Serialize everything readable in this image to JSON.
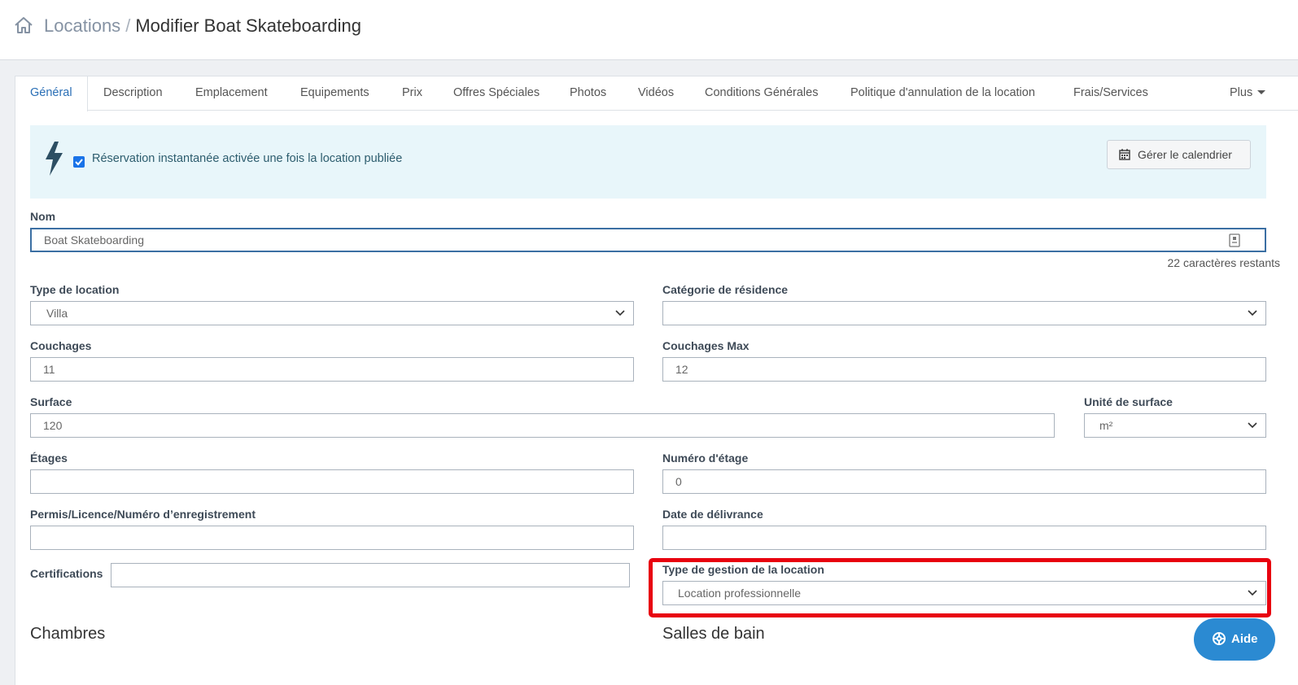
{
  "breadcrumb": {
    "parent": "Locations",
    "separator": "/",
    "current": "Modifier Boat Skateboarding"
  },
  "tabs": [
    {
      "label": "Général",
      "active": true
    },
    {
      "label": "Description"
    },
    {
      "label": "Emplacement"
    },
    {
      "label": "Equipements"
    },
    {
      "label": "Prix"
    },
    {
      "label": "Offres Spéciales"
    },
    {
      "label": "Photos"
    },
    {
      "label": "Vidéos"
    },
    {
      "label": "Conditions Générales"
    },
    {
      "label": "Politique d'annulation de la location"
    },
    {
      "label": "Frais/Services"
    },
    {
      "label": "Plus"
    }
  ],
  "instant_booking": {
    "checked": true,
    "text": "Réservation instantanée activée une fois la location publiée",
    "calendar_button": "Gérer le calendrier"
  },
  "form": {
    "nom": {
      "label": "Nom",
      "value": "Boat Skateboarding",
      "remaining": "22 caractères restants"
    },
    "type_location": {
      "label": "Type de location",
      "value": "Villa"
    },
    "categorie_residence": {
      "label": "Catégorie de résidence",
      "value": ""
    },
    "couchages": {
      "label": "Couchages",
      "value": "11"
    },
    "couchages_max": {
      "label": "Couchages Max",
      "value": "12"
    },
    "surface": {
      "label": "Surface",
      "value": "120"
    },
    "unite_surface": {
      "label": "Unité de surface",
      "value": "m²"
    },
    "etages": {
      "label": "Étages",
      "value": ""
    },
    "numero_etage": {
      "label": "Numéro d'étage",
      "value": "0"
    },
    "permis": {
      "label": "Permis/Licence/Numéro d’enregistrement",
      "value": ""
    },
    "date_delivrance": {
      "label": "Date de délivrance",
      "value": ""
    },
    "certifications": {
      "label": "Certifications",
      "value": ""
    },
    "type_gestion": {
      "label": "Type de gestion de la location",
      "value": "Location professionnelle"
    }
  },
  "sections": {
    "chambres": "Chambres",
    "salles_de_bain": "Salles de bain"
  },
  "help_button": "Aide",
  "colors": {
    "accent": "#2a6fb6",
    "alert_bg": "#e8f6fa",
    "highlight": "#e8000f",
    "help_bg": "#2b8ad2"
  }
}
